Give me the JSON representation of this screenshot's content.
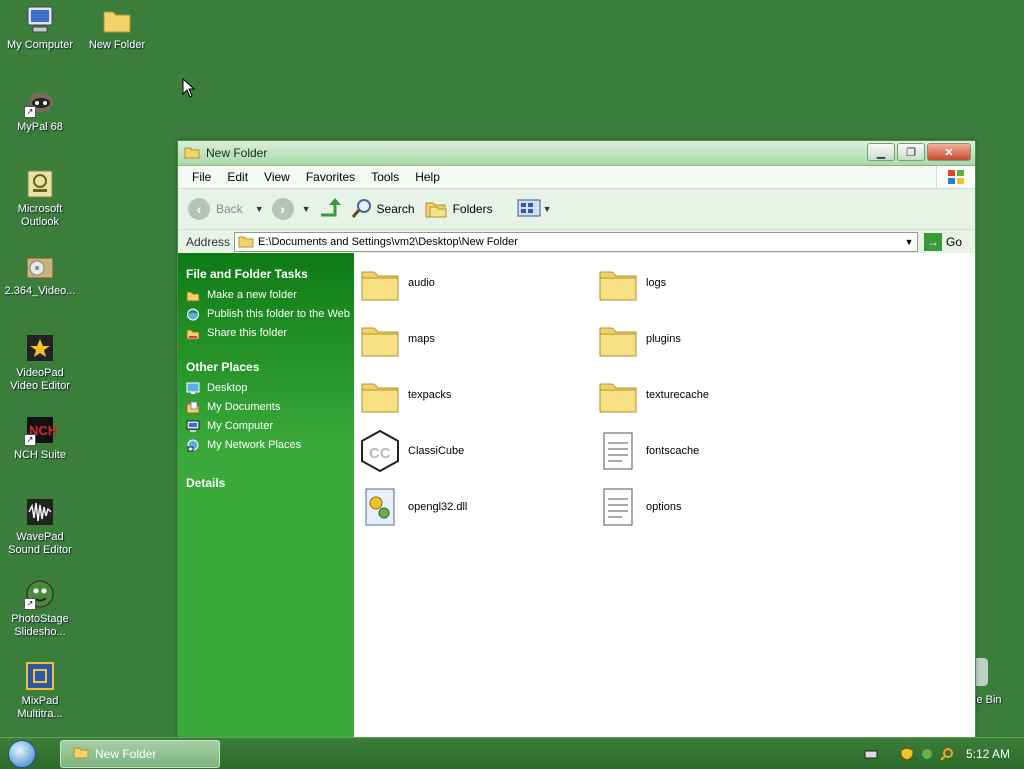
{
  "desktop": {
    "icons": [
      {
        "label": "My Computer",
        "icon": "computer-icon"
      },
      {
        "label": "New Folder",
        "icon": "folder-icon"
      },
      {
        "label": "MyPal 68",
        "icon": "mypal-icon"
      },
      {
        "label": "Microsoft Outlook",
        "icon": "outlook-icon"
      },
      {
        "label": "2.364_Video...",
        "icon": "installer-icon"
      },
      {
        "label": "VideoPad Video Editor",
        "icon": "videopad-icon"
      },
      {
        "label": "NCH Suite",
        "icon": "nch-icon"
      },
      {
        "label": "WavePad Sound Editor",
        "icon": "wavepad-icon"
      },
      {
        "label": "PhotoStage Slidesho...",
        "icon": "photostage-icon"
      },
      {
        "label": "MixPad Multitra...",
        "icon": "mixpad-icon"
      }
    ],
    "recycle_bin_partial": "le Bin"
  },
  "window": {
    "title": "New Folder",
    "menu": [
      "File",
      "Edit",
      "View",
      "Favorites",
      "Tools",
      "Help"
    ],
    "toolbar": {
      "back": "Back",
      "search": "Search",
      "folders": "Folders"
    },
    "address": {
      "label": "Address",
      "path": "E:\\Documents and Settings\\vm2\\Desktop\\New Folder",
      "go": "Go"
    },
    "taskpane": {
      "file_tasks": {
        "title": "File and Folder Tasks",
        "items": [
          "Make a new folder",
          "Publish this folder to the Web",
          "Share this folder"
        ]
      },
      "other_places": {
        "title": "Other Places",
        "items": [
          "Desktop",
          "My Documents",
          "My Computer",
          "My Network Places"
        ]
      },
      "details": {
        "title": "Details"
      }
    },
    "files": [
      {
        "name": "audio",
        "type": "folder"
      },
      {
        "name": "logs",
        "type": "folder"
      },
      {
        "name": "maps",
        "type": "folder"
      },
      {
        "name": "plugins",
        "type": "folder"
      },
      {
        "name": "texpacks",
        "type": "folder"
      },
      {
        "name": "texturecache",
        "type": "folder"
      },
      {
        "name": "ClassiCube",
        "type": "app"
      },
      {
        "name": "fontscache",
        "type": "text"
      },
      {
        "name": "opengl32.dll",
        "type": "dll"
      },
      {
        "name": "options",
        "type": "text"
      }
    ]
  },
  "taskbar": {
    "task_label": "New Folder",
    "clock": "5:12 AM"
  },
  "colors": {
    "desktop_bg": "#3b7d3a",
    "task_pane": "#2e9a2e",
    "folder_yellow": "#f2d36b"
  }
}
